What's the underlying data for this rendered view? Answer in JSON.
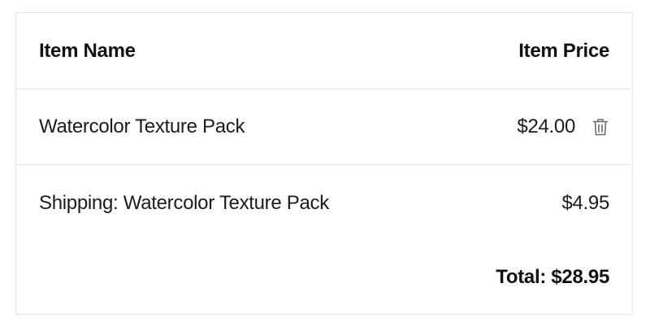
{
  "table": {
    "header": {
      "item_name": "Item Name",
      "item_price": "Item Price"
    },
    "rows": [
      {
        "name": "Watercolor Texture Pack",
        "price": "$24.00",
        "icon": "trash-icon",
        "removable": true
      },
      {
        "name": "Shipping: Watercolor Texture Pack",
        "price": "$4.95",
        "removable": false
      }
    ],
    "total": "Total: $28.95"
  },
  "colors": {
    "text": "#1c1c1c",
    "border": "#e6e6e6",
    "icon": "#6b6b6b"
  }
}
